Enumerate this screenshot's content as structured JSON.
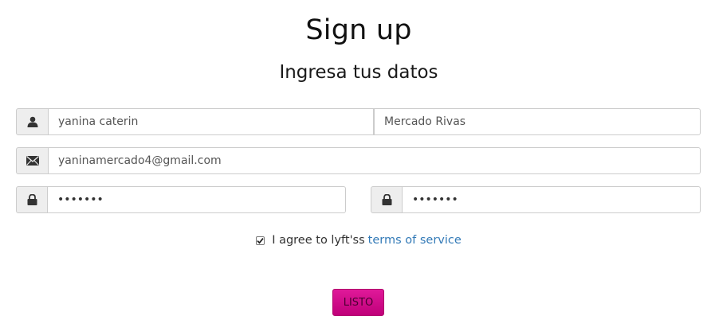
{
  "header": {
    "title": "Sign up",
    "subtitle": "Ingresa tus datos"
  },
  "form": {
    "first_name": {
      "value": "yanina caterin",
      "icon": "user-icon"
    },
    "last_name": {
      "value": "Mercado Rivas"
    },
    "email": {
      "value": "yaninamercado4@gmail.com",
      "icon": "envelope-icon"
    },
    "password": {
      "value": "•••••••",
      "icon": "lock-icon"
    },
    "confirm_password": {
      "value": "•••••••",
      "icon": "lock-icon"
    },
    "agree": {
      "checked": true,
      "text": "I agree to lyft'ss",
      "link_text": "terms of service"
    },
    "submit_label": "LISTO"
  },
  "colors": {
    "accent": "#c0007a",
    "link": "#337ab7",
    "addon_bg": "#eeeeee",
    "border": "#cccccc"
  }
}
